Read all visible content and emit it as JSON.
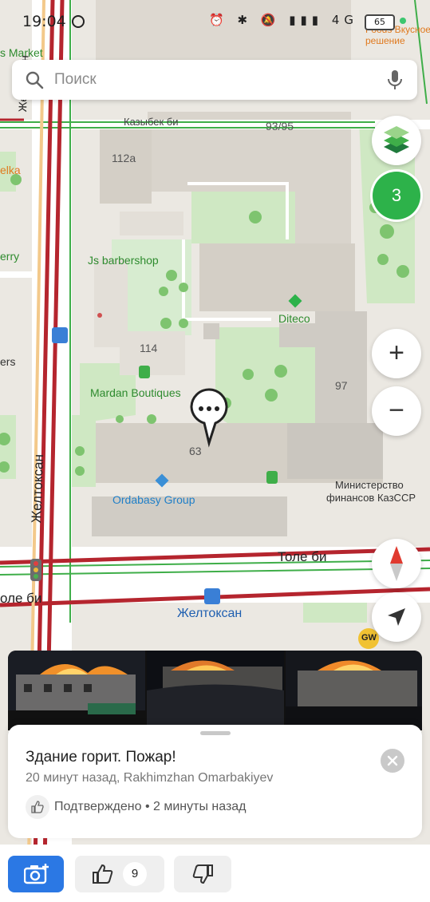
{
  "status_bar": {
    "time": "19:04",
    "icons_text": "⏰ ✱ 🔕 ▮▮▮ 4G",
    "battery": "65"
  },
  "search": {
    "placeholder": "Поиск"
  },
  "map": {
    "labels": {
      "market": "s Market",
      "foods": "Foods Вкусное",
      "foods2": "решение",
      "street_kazybek": "Казыбек би",
      "bldg_93": "93/95",
      "bldg_112a": "112а",
      "elka": "elka",
      "erry": "erry",
      "ers": "ers",
      "barbershop": "Js barbershop",
      "diteco": "Diteco",
      "bldg_114": "114",
      "bldg_97": "97",
      "mardan": "Mardan Boutiques",
      "bldg_63": "63",
      "ordabasy": "Ordabasy Group",
      "ministry": "Министерство",
      "ministry2": "финансов КазССР",
      "street_zheltoksan_v1": "Желтоксан",
      "street_zheltoksan_v2": "Желтоксан",
      "street_tole_bi_right": "Толе би",
      "street_tole_bi_left": "оле би",
      "stop_zheltoksan": "Желтоксан",
      "gw": "GW"
    },
    "cluster_count": "3",
    "colors": {
      "road_red": "#b5252e",
      "park_green": "#cfe8c3",
      "building": "#d9d4cc",
      "accent_green": "#2db24a",
      "accent_blue": "#2b78e4"
    }
  },
  "controls": {
    "zoom_in": "+",
    "zoom_out": "−"
  },
  "event_card": {
    "title": "Здание горит. Пожар!",
    "subtitle": "20 минут назад, Rakhimzhan Omarbakiyev",
    "confirm_text": "Подтверждено • 2 минуты назад"
  },
  "bottom_bar": {
    "like_count": "9"
  }
}
